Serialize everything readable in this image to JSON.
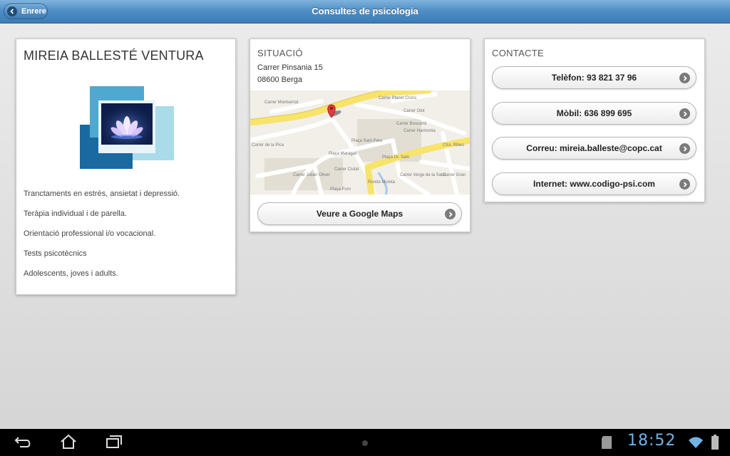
{
  "header": {
    "back_label": "Enrere",
    "title": "Consultes de psicologia"
  },
  "profile": {
    "name": "MIREIA BALLESTÉ VENTURA",
    "services": [
      "Tranctaments en estrés, ansietat i depressió.",
      "Teràpia individual i de parella.",
      "Orientació professional i/o vocacional.",
      "Tests psicotècnics",
      "Adolescents, joves i adults."
    ]
  },
  "situacio": {
    "title": "SITUACIÓ",
    "address_line1": "Carrer Pinsania 15",
    "address_line2": "08600 Berga",
    "maps_button": "Veure a Google Maps",
    "map_labels": [
      "Carrer Montserrat",
      "Carrer Placer Crons",
      "Carrer Olot",
      "Carrer Buscarol",
      "Carrer Harmonia",
      "Plaça Sant Pere",
      "Plaça Maragall",
      "Plaça Dr. Saló",
      "Ctra. Ribes",
      "Carrer de la Pica",
      "Carrer Ciutat",
      "Carrer Julián Oliver",
      "Plaça Forn",
      "Ronda Moreta",
      "Carrer Verge de la Salut",
      "Carrer Gran"
    ]
  },
  "contacte": {
    "title": "CONTACTE",
    "buttons": [
      "Telèfon: 93 821 37 96",
      "Mòbil: 636 899 695",
      "Correu: mireia.balleste@copc.cat",
      "Internet: www.codigo-psi.com"
    ]
  },
  "statusbar": {
    "time": "18:52"
  },
  "icons": {
    "back": "back-arrow-icon",
    "home": "home-icon",
    "recents": "recent-apps-icon",
    "sd": "sd-card-icon",
    "wifi": "wifi-icon",
    "battery": "battery-icon"
  },
  "colors": {
    "header": "#4f8fc6",
    "clock": "#6fb4e6",
    "logo_dark": "#1a6aa0",
    "logo_light": "#9fd3e6"
  }
}
